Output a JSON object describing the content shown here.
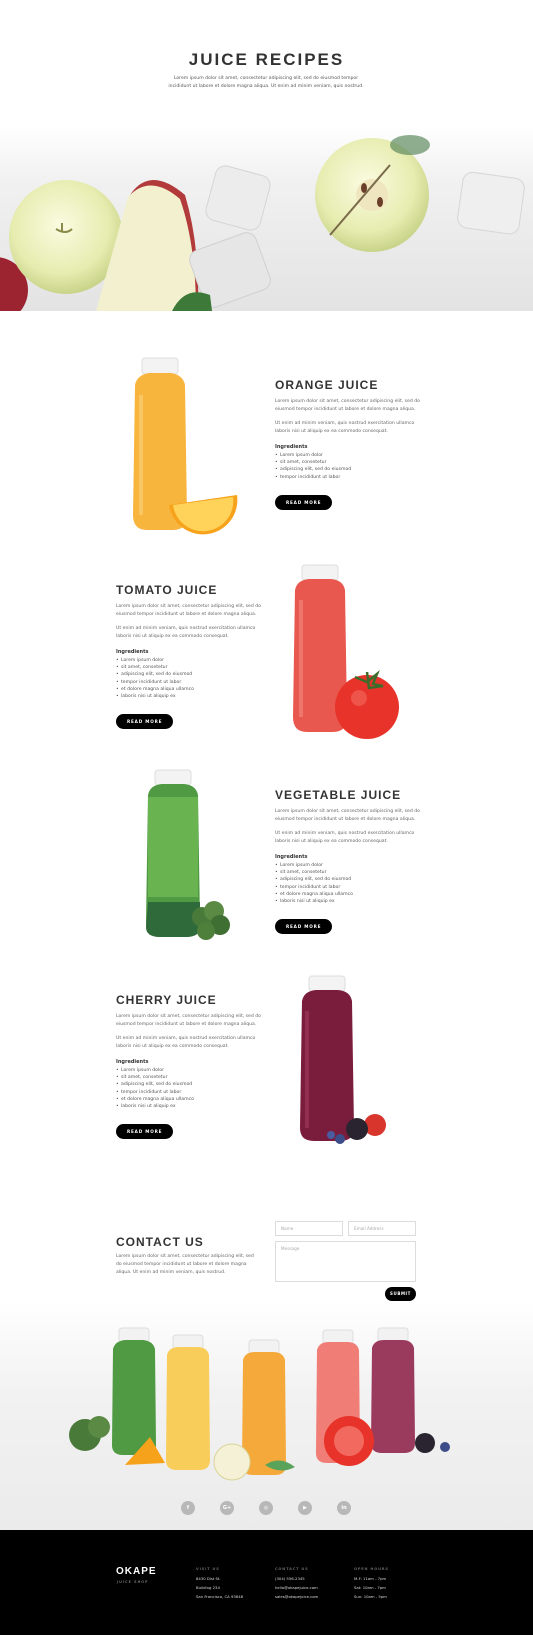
{
  "hero": {
    "title": "JUICE RECIPES",
    "text": "Lorem ipsum dolor sit amet, consectetur adipiscing elit, sed do eiusmod tempor incididunt ut labore et dolore magna aliqua. Ut enim ad minim veniam, quis nostrud."
  },
  "recipes": [
    {
      "title": "ORANGE JUICE",
      "p1": "Lorem ipsum dolor sit amet, consectetur adipiscing elit, sed do eiusmod tempor incididunt ut labore et dolore magna aliqua.",
      "p2": "Ut enim ad minim veniam, quis nostrud exercitation ullamco laboris nisi ut aliquip ex ea commodo consequat.",
      "ingredients_label": "Ingredients",
      "ingredients": [
        "Lorem ipsum dolor",
        "sit amet, consetetur",
        "adipiscing elit, sed do eiusmod",
        "tempor incididunt ut labor"
      ],
      "button": "READ MORE"
    },
    {
      "title": "TOMATO JUICE",
      "p1": "Lorem ipsum dolor sit amet, consectetur adipiscing elit, sed do eiusmod tempor incididunt ut labore et dolore magna aliqua.",
      "p2": "Ut enim ad minim veniam, quis nostrud exercitation ullamco laboris nisi ut aliquip ex ea commodo consequat.",
      "ingredients_label": "Ingredients",
      "ingredients": [
        "Lorem ipsum dolor",
        "sit amet, consetetur",
        "adipiscing elit, sed do eiusmod",
        "tempor incididunt ut labor",
        "et dolore magna aliqua ullamco",
        "laboris nisi ut aliquip ex"
      ],
      "button": "READ MORE"
    },
    {
      "title": "VEGETABLE JUICE",
      "p1": "Lorem ipsum dolor sit amet, consectetur adipiscing elit, sed do eiusmod tempor incididunt ut labore et dolore magna aliqua.",
      "p2": "Ut enim ad minim veniam, quis nostrud exercitation ullamco laboris nisi ut aliquip ex ea commodo consequat.",
      "ingredients_label": "Ingredients",
      "ingredients": [
        "Lorem ipsum dolor",
        "sit amet, consetetur",
        "adipiscing elit, sed do eiusmod",
        "tempor incididunt ut labor",
        "et dolore magna aliqua ullamco",
        "laboris nisi ut aliquip ex"
      ],
      "button": "READ MORE"
    },
    {
      "title": "CHERRY JUICE",
      "p1": "Lorem ipsum dolor sit amet, consectetur adipiscing elit, sed do eiusmod tempor incididunt ut labore et dolore magna aliqua.",
      "p2": "Ut enim ad minim veniam, quis nostrud exercitation ullamco laboris nisi ut aliquip ex ea commodo consequat.",
      "ingredients_label": "Ingredients",
      "ingredients": [
        "Lorem ipsum dolor",
        "sit amet, consetetur",
        "adipiscing elit, sed do eiusmod",
        "tempor incididunt ut labor",
        "et dolore magna aliqua ullamco",
        "laboris nisi ut aliquip ex"
      ],
      "button": "READ MORE"
    }
  ],
  "contact": {
    "title": "CONTACT US",
    "text": "Lorem ipsum dolor sit amet, consectetur adipiscing elit, sed do eiusmod tempor incididunt ut labore et dolore magna aliqua. Ut enim ad minim veniam, quis nostrud.",
    "name_placeholder": "Name",
    "email_placeholder": "Email Address",
    "message_placeholder": "Message",
    "submit": "SUBMIT"
  },
  "social": [
    {
      "icon": "facebook-icon",
      "glyph": "f"
    },
    {
      "icon": "google-plus-icon",
      "glyph": "G+"
    },
    {
      "icon": "instagram-icon",
      "glyph": "◎"
    },
    {
      "icon": "youtube-icon",
      "glyph": "▶"
    },
    {
      "icon": "linkedin-icon",
      "glyph": "in"
    }
  ],
  "footer": {
    "logo": "OKAPE",
    "logo_sub": "JUICE SHOP",
    "visit": {
      "heading": "VISIT US",
      "lines": [
        "8430 Dist St.",
        "Building 234",
        "San Francisco, CA 93848"
      ]
    },
    "contact": {
      "heading": "CONTACT US",
      "lines": [
        "(304) 556-2345",
        "hello@okapejuice.com",
        "sales@okapejuice.com"
      ]
    },
    "hours": {
      "heading": "OPEN HOURS",
      "lines": [
        "M-F: 11am - 7pm",
        "Sat: 10am - 7pm",
        "Sun: 10am - 5pm"
      ]
    }
  },
  "colors": {
    "orange": "#f7b53e",
    "tomato": "#e9584e",
    "vegetable": "#4f9a43",
    "cherry": "#7a1d3c",
    "button": "#000000"
  }
}
